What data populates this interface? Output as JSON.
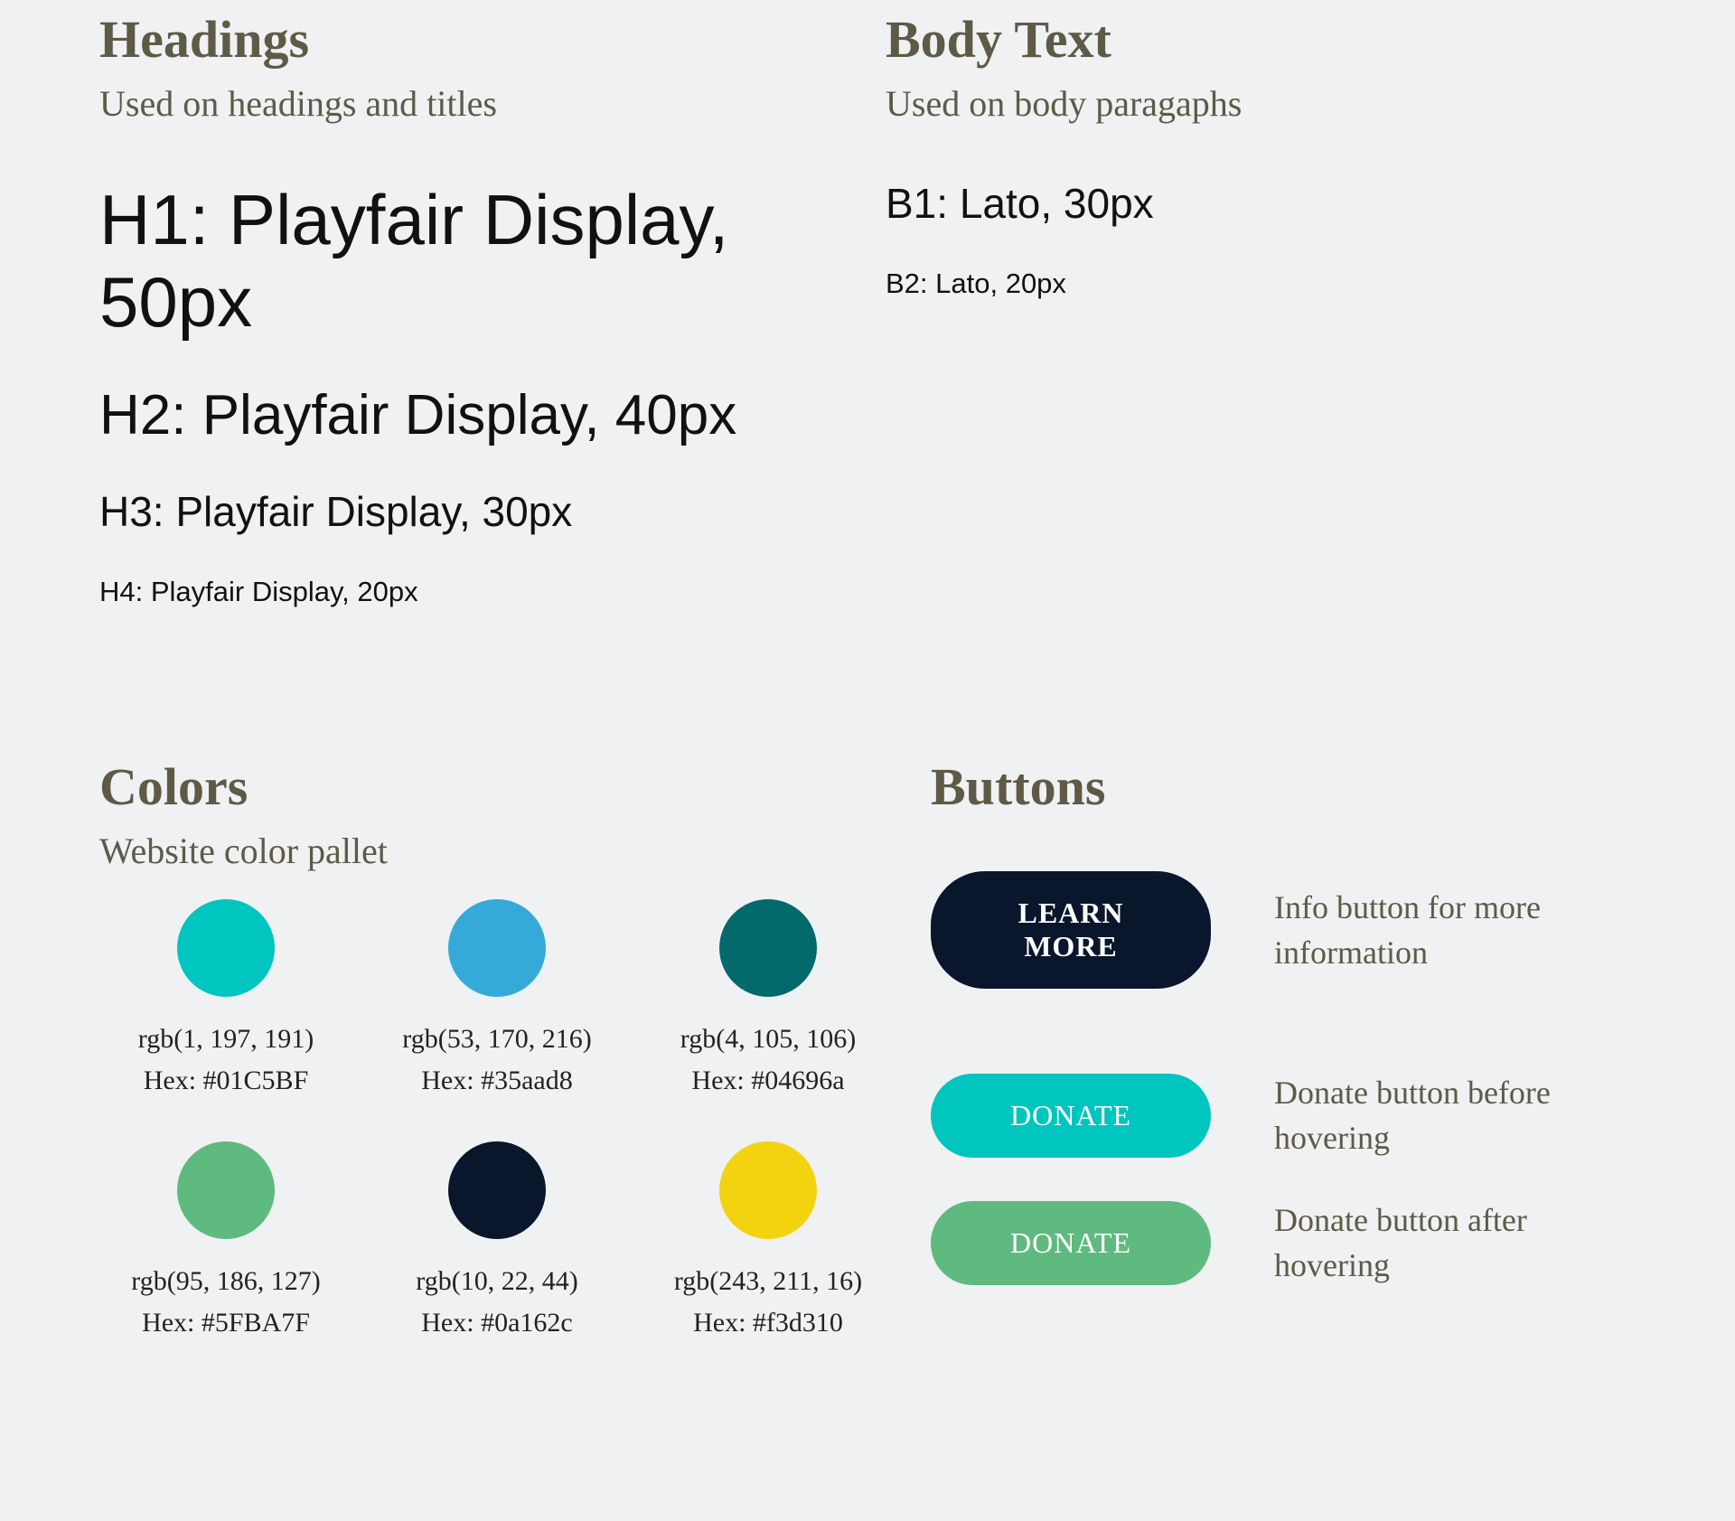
{
  "headings": {
    "title": "Headings",
    "subtitle": "Used on headings and titles",
    "samples": {
      "h1": "H1: Playfair Display, 50px",
      "h2": "H2: Playfair Display, 40px",
      "h3": "H3: Playfair Display, 30px",
      "h4": "H4: Playfair Display, 20px"
    }
  },
  "body_text": {
    "title": "Body Text",
    "subtitle": "Used on body paragaphs",
    "samples": {
      "b1": "B1: Lato, 30px",
      "b2": "B2: Lato, 20px"
    }
  },
  "colors": {
    "title": "Colors",
    "subtitle": "Website color pallet",
    "swatches": [
      {
        "rgb": "rgb(1, 197, 191)",
        "hex_label": "Hex: #01C5BF",
        "hex": "#01C5BF"
      },
      {
        "rgb": "rgb(53, 170, 216)",
        "hex_label": "Hex: #35aad8",
        "hex": "#35aad8"
      },
      {
        "rgb": "rgb(4, 105, 106)",
        "hex_label": "Hex: #04696a",
        "hex": "#04696a"
      },
      {
        "rgb": "rgb(95, 186, 127)",
        "hex_label": "Hex: #5FBA7F",
        "hex": "#5FBA7F"
      },
      {
        "rgb": "rgb(10, 22, 44)",
        "hex_label": "Hex: #0a162c",
        "hex": "#0a162c"
      },
      {
        "rgb": "rgb(243, 211, 16)",
        "hex_label": "Hex: #f3d310",
        "hex": "#f3d310"
      }
    ]
  },
  "buttons": {
    "title": "Buttons",
    "items": [
      {
        "label": "LEARN MORE",
        "desc": "Info button for more information",
        "style": "dark"
      },
      {
        "label": "DONATE",
        "desc": "Donate button before hovering",
        "style": "teal"
      },
      {
        "label": "DONATE",
        "desc": "Donate button after hovering",
        "style": "green"
      }
    ]
  }
}
